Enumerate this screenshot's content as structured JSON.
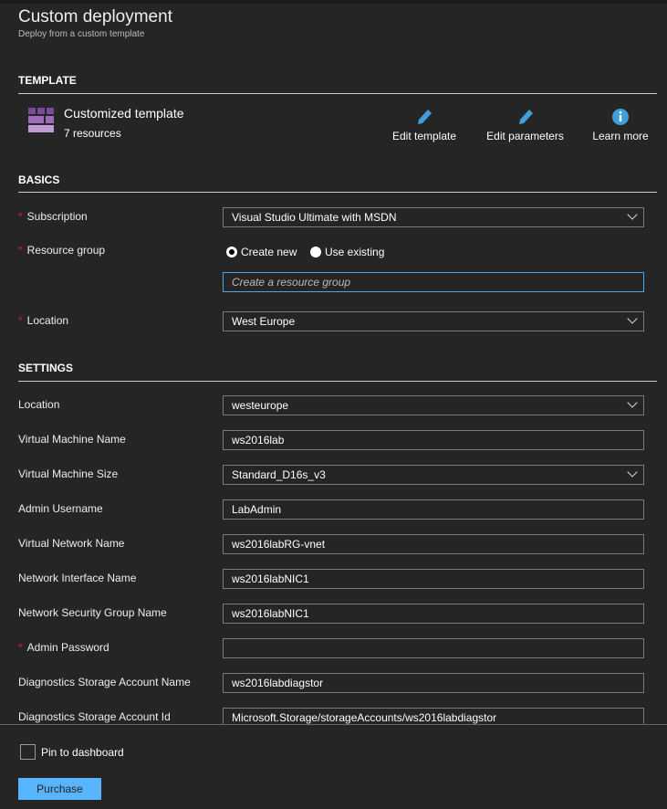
{
  "header": {
    "title": "Custom deployment",
    "subtitle": "Deploy from a custom template"
  },
  "template": {
    "section": "TEMPLATE",
    "name": "Customized template",
    "resources": "7 resources",
    "actions": [
      {
        "label": "Edit template",
        "icon": "pencil-icon"
      },
      {
        "label": "Edit parameters",
        "icon": "pencil-icon"
      },
      {
        "label": "Learn more",
        "icon": "info-icon"
      }
    ]
  },
  "basics": {
    "section": "BASICS",
    "subscription": {
      "label": "Subscription",
      "value": "Visual Studio Ultimate with MSDN"
    },
    "resource_group": {
      "label": "Resource group",
      "create_new": "Create new",
      "use_existing": "Use existing",
      "placeholder": "Create a resource group",
      "selected": "Create new"
    },
    "location": {
      "label": "Location",
      "value": "West Europe"
    }
  },
  "settings": {
    "section": "SETTINGS",
    "fields": [
      {
        "label": "Location",
        "value": "westeurope",
        "type": "select",
        "required": false
      },
      {
        "label": "Virtual Machine Name",
        "value": "ws2016lab",
        "type": "text",
        "required": false
      },
      {
        "label": "Virtual Machine Size",
        "value": "Standard_D16s_v3",
        "type": "select",
        "required": false
      },
      {
        "label": "Admin Username",
        "value": "LabAdmin",
        "type": "text",
        "required": false
      },
      {
        "label": "Virtual Network Name",
        "value": "ws2016labRG-vnet",
        "type": "text",
        "required": false
      },
      {
        "label": "Network Interface Name",
        "value": "ws2016labNIC1",
        "type": "text",
        "required": false
      },
      {
        "label": "Network Security Group Name",
        "value": "ws2016labNIC1",
        "type": "text",
        "required": false
      },
      {
        "label": "Admin Password",
        "value": "",
        "type": "password",
        "required": true
      },
      {
        "label": "Diagnostics Storage Account Name",
        "value": "ws2016labdiagstor",
        "type": "text",
        "required": false
      },
      {
        "label": "Diagnostics Storage Account Id",
        "value": "Microsoft.Storage/storageAccounts/ws2016labdiagstor",
        "type": "text",
        "required": false
      }
    ]
  },
  "footer": {
    "pin_label": "Pin to dashboard",
    "pinned": false,
    "purchase": "Purchase"
  },
  "colors": {
    "background": "#252525",
    "accent": "#59b4ff",
    "required": "#e81123",
    "icon_blue": "#3ea0db",
    "template_purple": "#8e5ba6"
  }
}
